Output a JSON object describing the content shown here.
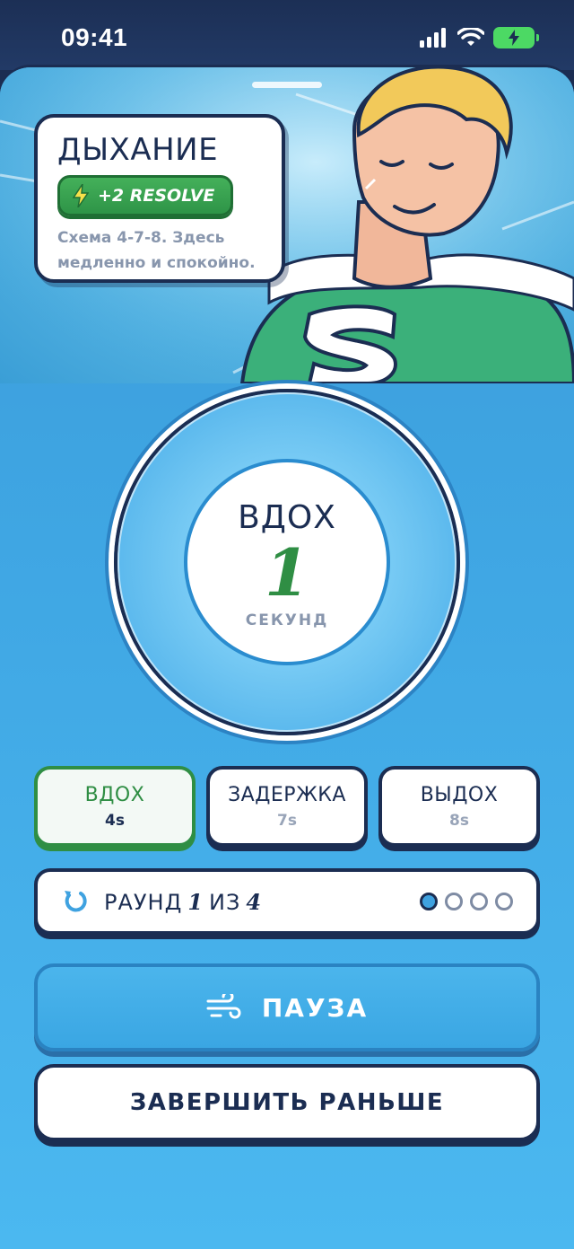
{
  "status_bar": {
    "time": "09:41",
    "icons": [
      "signal-icon",
      "wifi-icon",
      "battery-charging-icon"
    ]
  },
  "exercise": {
    "title": "ДЫХАНИЕ",
    "reward_label": "+2 RESOLVE",
    "reward_icon": "lightning-icon",
    "description": "Схема 4-7-8. Здесь медленно и спокойно."
  },
  "timer": {
    "phase": "ВДОХ",
    "count": "1",
    "unit": "СЕКУНД"
  },
  "phases": [
    {
      "name": "ВДОХ",
      "duration": "4s",
      "active": true
    },
    {
      "name": "ЗАДЕРЖКА",
      "duration": "7s",
      "active": false
    },
    {
      "name": "ВЫДОХ",
      "duration": "8s",
      "active": false
    }
  ],
  "round": {
    "prefix": "РАУНД",
    "current": "1",
    "separator": "ИЗ",
    "total": "4",
    "icon": "repeat-icon",
    "completed_dots": 1,
    "dot_count": 4
  },
  "actions": {
    "pause_label": "ПАУЗА",
    "pause_icon": "wind-icon",
    "finish_label": "ЗАВЕРШИТЬ РАНЬШЕ"
  },
  "colors": {
    "navy": "#1b2d52",
    "accent_green": "#2f8e44",
    "accent_blue": "#3fa6e3",
    "muted_text": "#8896ad"
  }
}
